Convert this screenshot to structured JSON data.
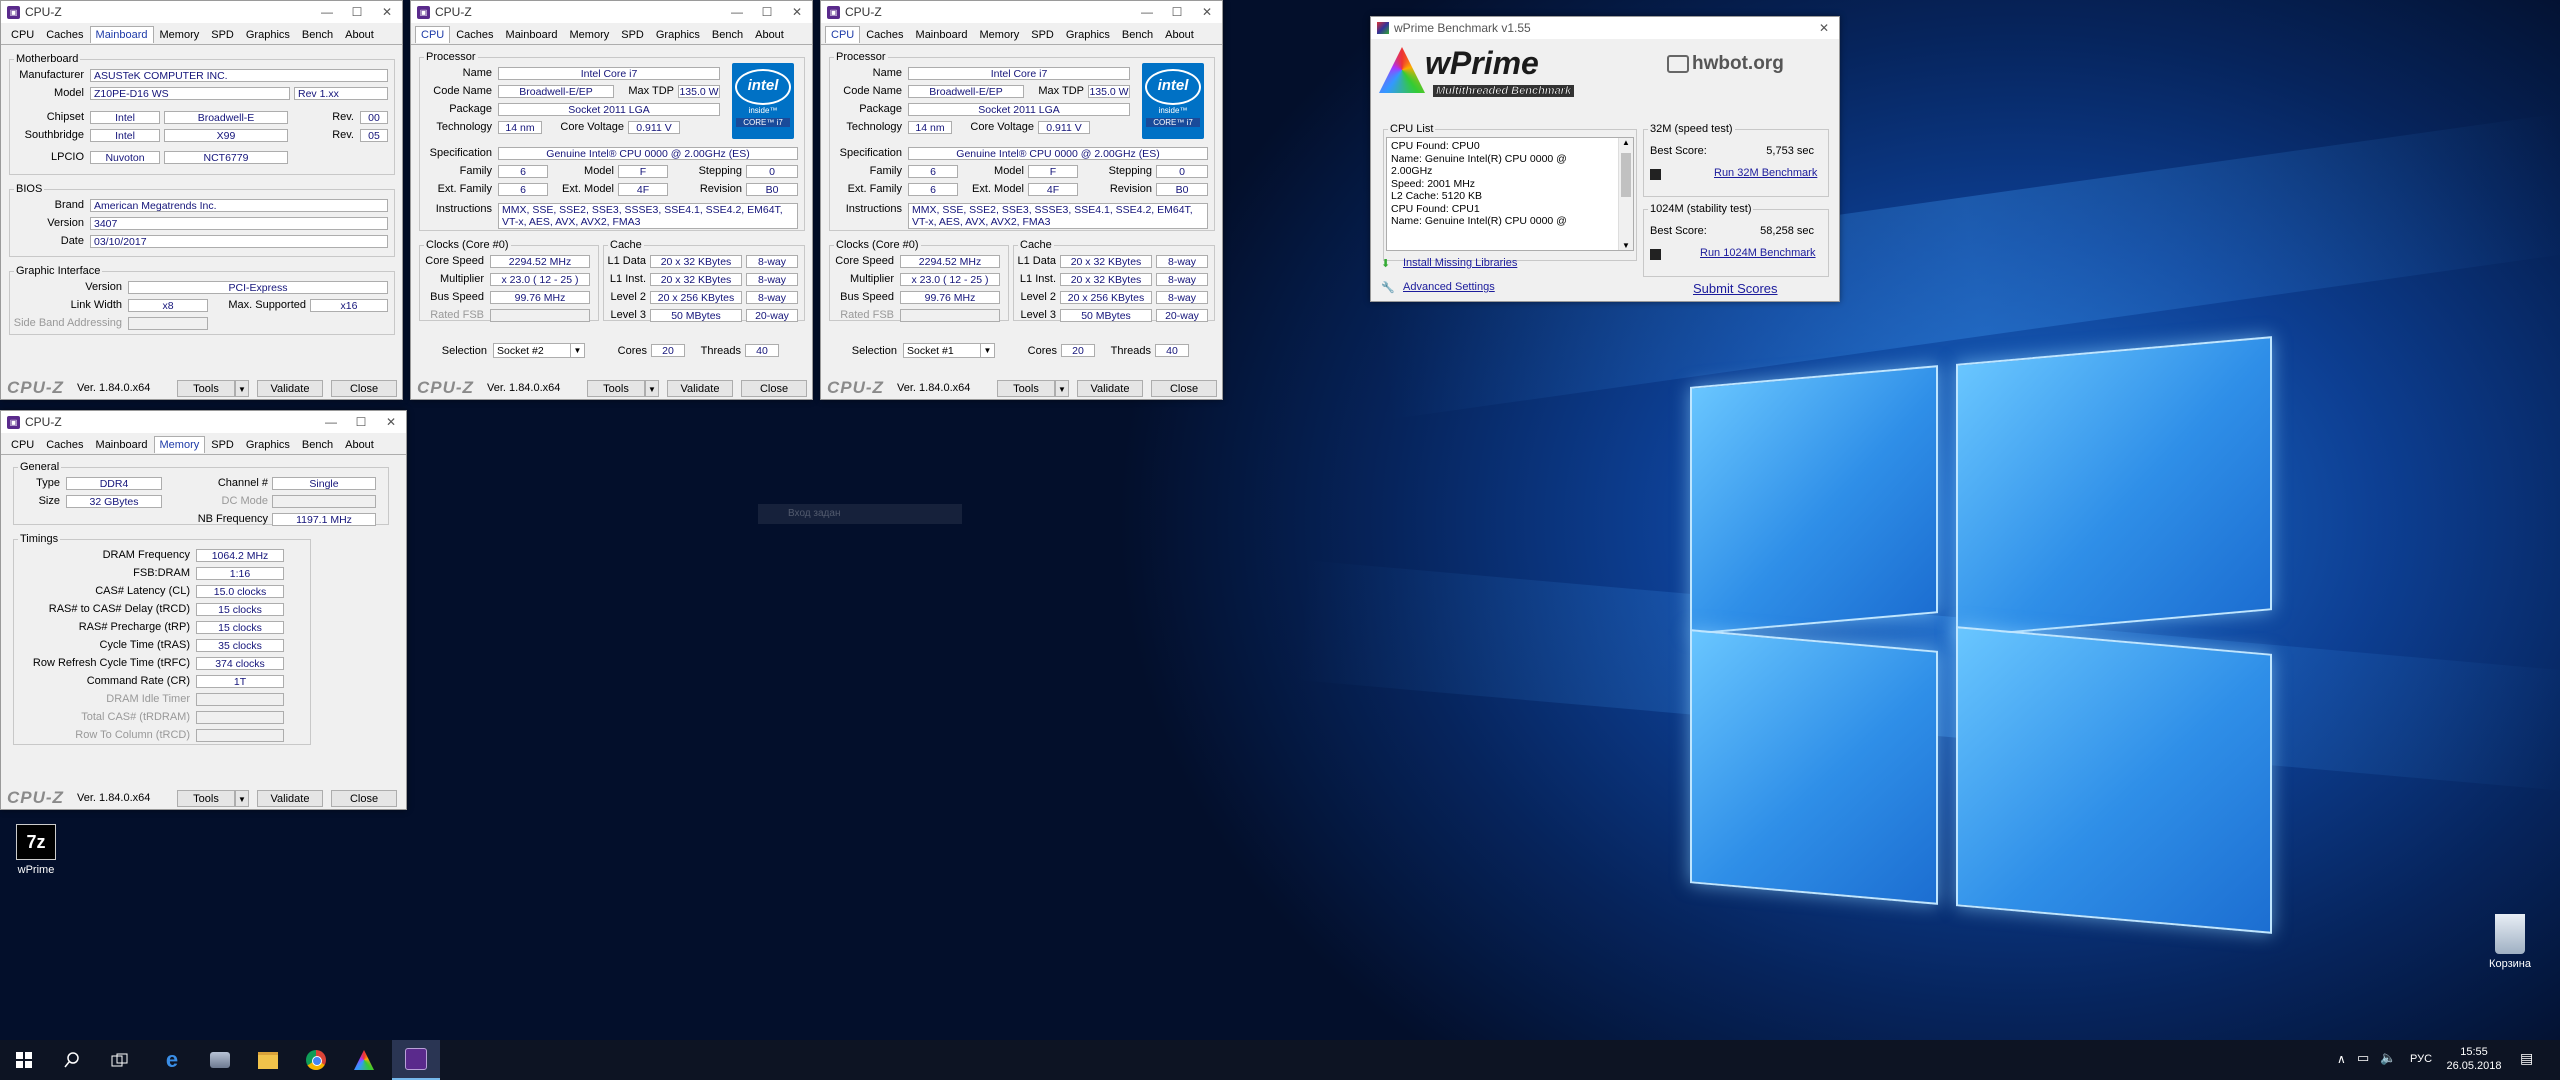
{
  "cpuz_title": "CPU-Z",
  "tabs": [
    "CPU",
    "Caches",
    "Mainboard",
    "Memory",
    "SPD",
    "Graphics",
    "Bench",
    "About"
  ],
  "bottom": {
    "logo": "CPU-Z",
    "version": "Ver. 1.84.0.x64",
    "tools": "Tools",
    "validate": "Validate",
    "close": "Close"
  },
  "mainboard": {
    "motherboard_legend": "Motherboard",
    "manufacturer_label": "Manufacturer",
    "manufacturer": "ASUSTeK COMPUTER INC.",
    "model_label": "Model",
    "model": "Z10PE-D16 WS",
    "model_rev": "Rev 1.xx",
    "chipset_label": "Chipset",
    "chipset_vendor": "Intel",
    "chipset": "Broadwell-E",
    "rev_label": "Rev.",
    "chipset_rev": "00",
    "southbridge_label": "Southbridge",
    "sb_vendor": "Intel",
    "sb": "X99",
    "sb_rev": "05",
    "lpcio_label": "LPCIO",
    "lpcio_vendor": "Nuvoton",
    "lpcio": "NCT6779",
    "bios_legend": "BIOS",
    "brand_label": "Brand",
    "brand": "American Megatrends Inc.",
    "version_label": "Version",
    "version": "3407",
    "date_label": "Date",
    "date": "03/10/2017",
    "gi_legend": "Graphic Interface",
    "gi_version_label": "Version",
    "gi_version": "PCI-Express",
    "link_width_label": "Link Width",
    "link_width": "x8",
    "max_supported_label": "Max. Supported",
    "max_supported": "x16",
    "side_band_label": "Side Band Addressing"
  },
  "memory": {
    "general_legend": "General",
    "type_label": "Type",
    "type": "DDR4",
    "size_label": "Size",
    "size": "32 GBytes",
    "channel_label": "Channel #",
    "channel": "Single",
    "dc_mode_label": "DC Mode",
    "nb_freq_label": "NB Frequency",
    "nb_freq": "1197.1 MHz",
    "timings_legend": "Timings",
    "timings": [
      {
        "label": "DRAM Frequency",
        "value": "1064.2 MHz"
      },
      {
        "label": "FSB:DRAM",
        "value": "1:16"
      },
      {
        "label": "CAS# Latency (CL)",
        "value": "15.0 clocks"
      },
      {
        "label": "RAS# to CAS# Delay (tRCD)",
        "value": "15 clocks"
      },
      {
        "label": "RAS# Precharge (tRP)",
        "value": "15 clocks"
      },
      {
        "label": "Cycle Time (tRAS)",
        "value": "35 clocks"
      },
      {
        "label": "Row Refresh Cycle Time (tRFC)",
        "value": "374 clocks"
      },
      {
        "label": "Command Rate (CR)",
        "value": "1T"
      },
      {
        "label": "DRAM Idle Timer",
        "value": ""
      },
      {
        "label": "Total CAS# (tRDRAM)",
        "value": ""
      },
      {
        "label": "Row To Column (tRCD)",
        "value": ""
      }
    ]
  },
  "cpu": {
    "processor_legend": "Processor",
    "name_label": "Name",
    "name": "Intel Core i7",
    "codename_label": "Code Name",
    "codename": "Broadwell-E/EP",
    "maxtdp_label": "Max TDP",
    "maxtdp": "135.0 W",
    "package_label": "Package",
    "package": "Socket 2011 LGA",
    "tech_label": "Technology",
    "tech": "14 nm",
    "voltage_label": "Core Voltage",
    "voltage": "0.911 V",
    "spec_label": "Specification",
    "spec": "Genuine Intel® CPU 0000 @ 2.00GHz (ES)",
    "family_label": "Family",
    "family": "6",
    "model_label": "Model",
    "model": "F",
    "stepping_label": "Stepping",
    "stepping": "0",
    "extfamily_label": "Ext. Family",
    "extfamily": "6",
    "extmodel_label": "Ext. Model",
    "extmodel": "4F",
    "revision_label": "Revision",
    "revision": "B0",
    "instr_label": "Instructions",
    "instr": "MMX, SSE, SSE2, SSE3, SSSE3, SSE4.1, SSE4.2, EM64T, VT-x, AES, AVX, AVX2, FMA3",
    "clocks_legend": "Clocks (Core #0)",
    "corespeed_label": "Core Speed",
    "corespeed": "2294.52 MHz",
    "multiplier_label": "Multiplier",
    "multiplier": "x 23.0 ( 12 - 25 )",
    "busspeed_label": "Bus Speed",
    "busspeed": "99.76 MHz",
    "ratedfsb_label": "Rated FSB",
    "cache_legend": "Cache",
    "l1d_label": "L1 Data",
    "l1d": "20 x 32 KBytes",
    "l1d_way": "8-way",
    "l1i_label": "L1 Inst.",
    "l1i": "20 x 32 KBytes",
    "l1i_way": "8-way",
    "l2_label": "Level 2",
    "l2": "20 x 256 KBytes",
    "l2_way": "8-way",
    "l3_label": "Level 3",
    "l3": "50 MBytes",
    "l3_way": "20-way",
    "selection_label": "Selection",
    "cores_label": "Cores",
    "cores": "20",
    "threads_label": "Threads",
    "threads": "40",
    "intel_logo": "intel",
    "intel_inside": "inside™",
    "intel_core": "CORE™ i7"
  },
  "socket_a": "Socket #2",
  "socket_b": "Socket #1",
  "wprime": {
    "title": "wPrime Benchmark v1.55",
    "logo": "wPrime",
    "tagline": "Multithreaded Benchmark",
    "hwbot": "hwbot.org",
    "cpulist_legend": "CPU List",
    "cpulist": [
      "CPU Found: CPU0",
      "Name:   Genuine Intel(R) CPU 0000 @",
      "2.00GHz",
      "Speed:  2001 MHz",
      "L2 Cache: 5120 KB",
      "CPU Found: CPU1",
      "Name:   Genuine Intel(R) CPU 0000 @"
    ],
    "s32_legend": "32M (speed test)",
    "best_label": "Best Score:",
    "s32_score": "5,753 sec",
    "s32_run": "Run 32M Benchmark",
    "s1024_legend": "1024M (stability test)",
    "s1024_score": "58,258 sec",
    "s1024_run": "Run 1024M Benchmark",
    "install_libs": "Install Missing Libraries",
    "advanced": "Advanced Settings",
    "submit": "Submit Scores"
  },
  "desktop": {
    "wprime_icon_label": "wPrime",
    "wprime_icon_glyph": "7z",
    "recycle_label": "Корзина",
    "ghost_text": "Вход задан"
  },
  "taskbar": {
    "lang": "РУС",
    "time": "15:55",
    "date": "26.05.2018"
  }
}
